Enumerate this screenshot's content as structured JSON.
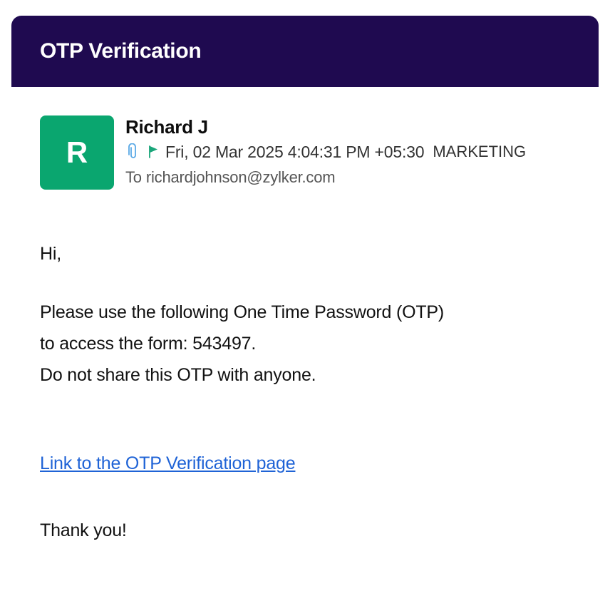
{
  "header": {
    "title": "OTP Verification",
    "color": "#1f0a50"
  },
  "sender": {
    "initial": "R",
    "avatar_color": "#0aa66f",
    "name": "Richard J",
    "date": "Fri, 02 Mar 2025 4:04:31 PM +05:30",
    "label": "MARKETING",
    "icons": [
      "paperclip-icon",
      "flag-icon"
    ],
    "recipient_prefix": "To",
    "recipient": "richardjohnson@zylker.com"
  },
  "body": {
    "greeting": "Hi,",
    "lines": [
      "Please use the following One Time Password (OTP)",
      "to access the form: 543497.",
      "Do not share this OTP with anyone."
    ],
    "link_text": "Link to the OTP Verification page",
    "link_color": "#1f63d6",
    "signoff": "Thank you!"
  }
}
